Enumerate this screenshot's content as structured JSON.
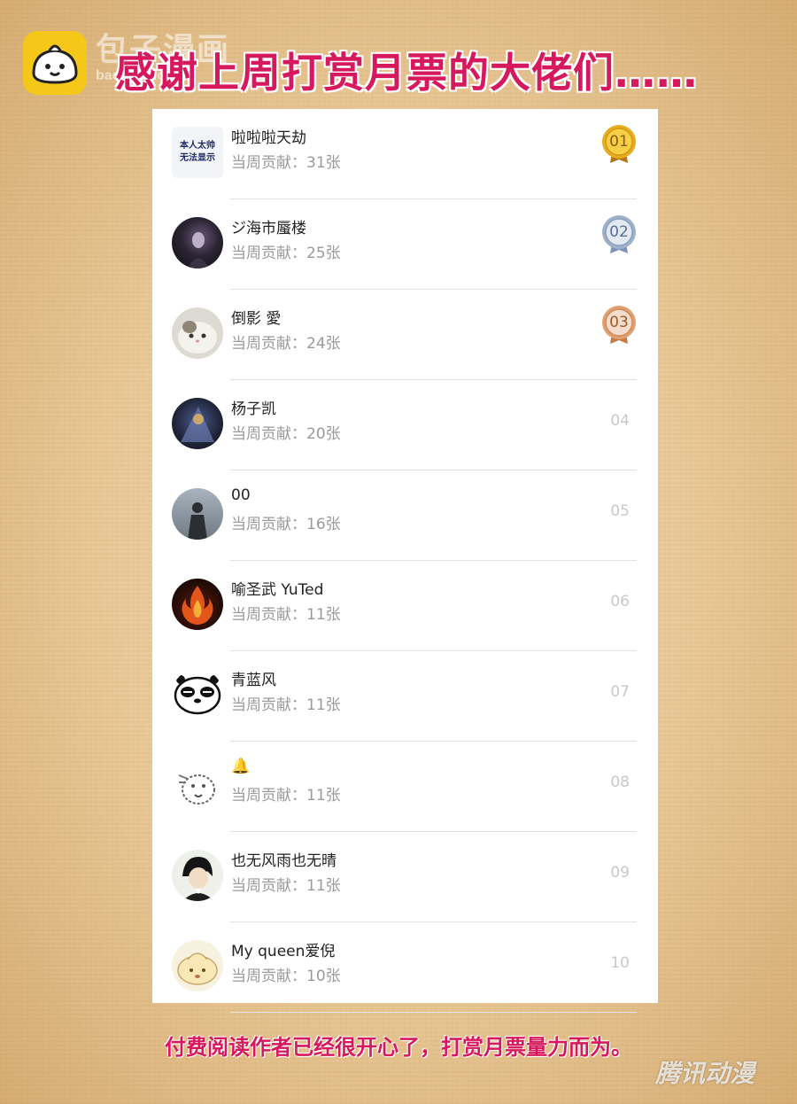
{
  "header": {
    "logo_icon": "bun-face-logo",
    "watermark_title": "包子漫画",
    "watermark_url": "baozimh.com",
    "headline": "感谢上周打赏月票的大佬们……"
  },
  "colors": {
    "accent": "#d6195c",
    "gold": "#e7ac1e",
    "silver": "#9fb0c9",
    "bronze": "#e1a070",
    "rank_plain": "#c8c8c8"
  },
  "leaderboard": {
    "rows": [
      {
        "name": "啦啦啦天劫",
        "contribution": "当周贡献：31张",
        "rank": "01",
        "medal": "gold",
        "avatar_icon": "text-avatar",
        "avatar_text": "本人太帅 无法显示"
      },
      {
        "name": "ジ海市蜃楼",
        "contribution": "当周贡献：25张",
        "rank": "02",
        "medal": "silver",
        "avatar_icon": "dark-figure-avatar"
      },
      {
        "name": "倒影 愛",
        "contribution": "当周贡献：24张",
        "rank": "03",
        "medal": "bronze",
        "avatar_icon": "cat-avatar"
      },
      {
        "name": "杨子凯",
        "contribution": "当周贡献：20张",
        "rank": "04",
        "medal": "",
        "avatar_icon": "warrior-avatar"
      },
      {
        "name": "00",
        "contribution": "当周贡献：16张",
        "rank": "05",
        "medal": "",
        "avatar_icon": "knight-avatar"
      },
      {
        "name": "喻圣武 YuTed",
        "contribution": "当周贡献：11张",
        "rank": "06",
        "medal": "",
        "avatar_icon": "fire-avatar"
      },
      {
        "name": "青蓝风",
        "contribution": "当周贡献：11张",
        "rank": "07",
        "medal": "",
        "avatar_icon": "panda-avatar"
      },
      {
        "name": "🔔",
        "contribution": "当周贡献：11张",
        "rank": "08",
        "medal": "",
        "avatar_icon": "sketch-avatar"
      },
      {
        "name": "也无风雨也无晴",
        "contribution": "当周贡献：11张",
        "rank": "09",
        "medal": "",
        "avatar_icon": "anime-boy-avatar"
      },
      {
        "name": "My queen爱倪",
        "contribution": "当周贡献：10张",
        "rank": "10",
        "medal": "",
        "avatar_icon": "bun-avatar"
      }
    ]
  },
  "footer": {
    "note": "付费阅读作者已经很开心了，打赏月票量力而为。",
    "brand": "腾讯动漫"
  }
}
